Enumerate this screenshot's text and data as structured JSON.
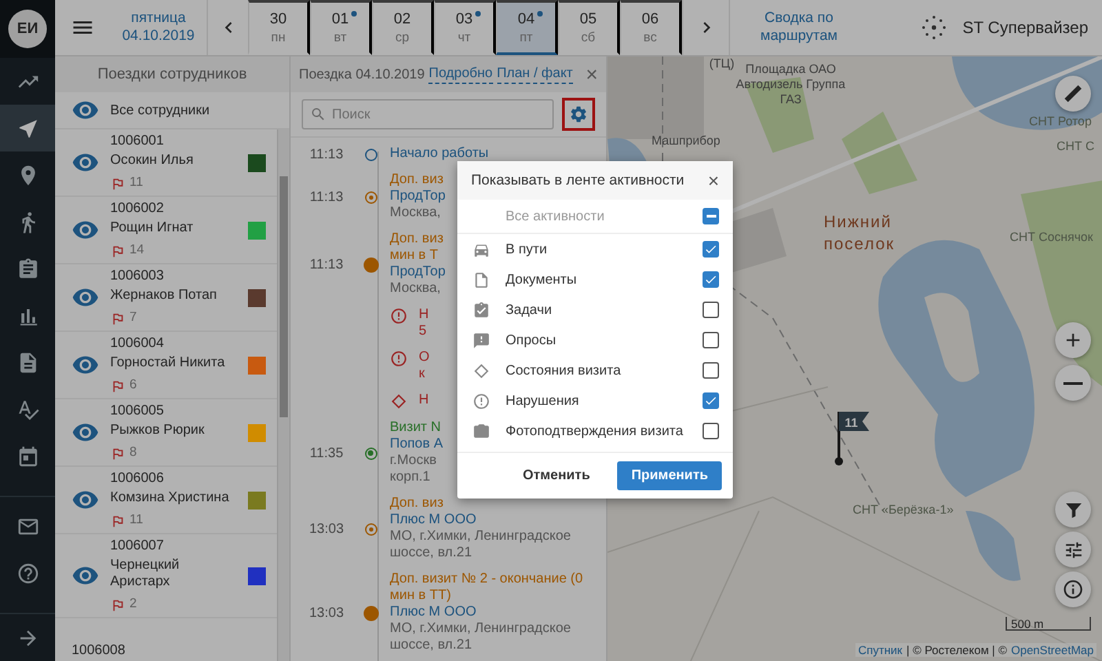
{
  "user": {
    "initials": "ЕИ"
  },
  "nav_items": [
    {
      "selected": false
    },
    {
      "selected": true
    },
    {
      "selected": false
    },
    {
      "selected": false
    },
    {
      "selected": false
    },
    {
      "selected": false
    },
    {
      "selected": false
    },
    {
      "selected": false
    },
    {
      "selected": false
    },
    {
      "selected": false
    },
    {
      "selected": false
    }
  ],
  "header": {
    "weekday": "пятница",
    "date": "04.10.2019",
    "days": [
      {
        "num": "30",
        "dow": "пн",
        "marker": false,
        "selected": false
      },
      {
        "num": "01",
        "dow": "вт",
        "marker": true,
        "selected": false
      },
      {
        "num": "02",
        "dow": "ср",
        "marker": false,
        "selected": false
      },
      {
        "num": "03",
        "dow": "чт",
        "marker": true,
        "selected": false
      },
      {
        "num": "04",
        "dow": "пт",
        "marker": true,
        "selected": true
      },
      {
        "num": "05",
        "dow": "сб",
        "marker": false,
        "selected": false
      },
      {
        "num": "06",
        "dow": "вс",
        "marker": false,
        "selected": false
      }
    ],
    "summary_link": "Сводка по маршрутам",
    "user_name": "ST Супервайзер"
  },
  "employees_panel": {
    "title": "Поездки сотрудников",
    "all_label": "Все сотрудники",
    "employees": [
      {
        "id": "1006001",
        "name": "Осокин Илья",
        "flags": "11",
        "color": "#1b4a1e"
      },
      {
        "id": "1006002",
        "name": "Рощин Игнат",
        "flags": "14",
        "color": "#22a044"
      },
      {
        "id": "1006003",
        "name": "Жернаков Потап",
        "flags": "7",
        "color": "#5a3a2e"
      },
      {
        "id": "1006004",
        "name": "Горностай Никита",
        "flags": "6",
        "color": "#c85a10"
      },
      {
        "id": "1006005",
        "name": "Рыжков Рюрик",
        "flags": "8",
        "color": "#d08c00"
      },
      {
        "id": "1006006",
        "name": "Комзина Христина",
        "flags": "11",
        "color": "#7a7a20"
      },
      {
        "id": "1006007",
        "name": "Чернецкий Аристарх",
        "flags": "2",
        "color": "#2030c0"
      },
      {
        "id": "1006008"
      }
    ]
  },
  "trip_panel": {
    "title": "Поездка 04.10.2019",
    "links": [
      "Подробно",
      "План / факт"
    ],
    "close": "×",
    "search": {
      "placeholder": "Поиск"
    },
    "settings_button": {
      "highlighted": true
    },
    "events": [
      {
        "time": "11:13",
        "kind": "open",
        "lines": [
          {
            "kind": "start",
            "text": "Начало работы"
          }
        ]
      },
      {
        "time": "11:13",
        "kind": "ring",
        "lines": [
          {
            "kind": "title",
            "text": "Доп. виз"
          },
          {
            "kind": "company",
            "text": "ПродТор"
          },
          {
            "kind": "address",
            "text": "Москва,"
          }
        ]
      },
      {
        "time": "11:13",
        "kind": "filled",
        "lines": [
          {
            "kind": "title",
            "text": "Доп. виз"
          },
          {
            "kind": "title",
            "text": "мин в Т"
          },
          {
            "kind": "company",
            "text": "ПродТор"
          },
          {
            "kind": "address",
            "text": "Москва,"
          }
        ]
      },
      {
        "kind": "alert",
        "lines": [
          {
            "kind": "violation",
            "text": "Н"
          },
          {
            "kind": "violation",
            "text": "5"
          }
        ]
      },
      {
        "kind": "alert",
        "lines": [
          {
            "kind": "violation",
            "text": "О"
          },
          {
            "kind": "violation",
            "text": "к"
          }
        ]
      },
      {
        "kind": "diamond",
        "lines": [
          {
            "kind": "violation",
            "text": "Н"
          }
        ]
      },
      {
        "time": "11:35",
        "kind": "visit",
        "lines": [
          {
            "kind": "visit",
            "text": "Визит N"
          },
          {
            "kind": "company",
            "text": "Попов А"
          },
          {
            "kind": "address",
            "text": "г.Москв"
          },
          {
            "kind": "address",
            "text": "корп.1"
          }
        ]
      },
      {
        "time": "13:03",
        "kind": "ring",
        "lines": [
          {
            "kind": "title",
            "text": "Доп. виз"
          },
          {
            "kind": "company",
            "text": "Плюс М ООО"
          },
          {
            "kind": "address",
            "text": "МО, г.Химки, Ленинградское шоссе, вл.21"
          }
        ]
      },
      {
        "time": "13:03",
        "kind": "filled",
        "lines": [
          {
            "kind": "title",
            "text": "Доп. визит № 2 - окончание (0 мин в ТТ)"
          },
          {
            "kind": "company",
            "text": "Плюс М ООО"
          },
          {
            "kind": "address",
            "text": "МО, г.Химки, Ленинградское шоссе, вл.21"
          }
        ]
      }
    ]
  },
  "map": {
    "labels": [
      {
        "kind": "poi",
        "text": "(ТЦ)"
      },
      {
        "kind": "poi",
        "text": "Площадка ОАО Автодизель Группа ГАЗ"
      },
      {
        "kind": "poi",
        "text": "Машприбор"
      },
      {
        "kind": "snt",
        "text": "СНТ Ротор"
      },
      {
        "kind": "snt",
        "text": "СНТ С"
      },
      {
        "kind": "snt",
        "text": "СНТ Соснячок"
      },
      {
        "kind": "settlement",
        "text": "Нижний поселок"
      },
      {
        "kind": "snt",
        "text": "СНТ «Берёзка-1»"
      }
    ],
    "marker": {
      "label": "11"
    },
    "scale": "500 m",
    "attribution": [
      {
        "text": "Спутник",
        "link": true
      },
      {
        "text": "| © Ростелеком | ©",
        "link": false
      },
      {
        "text": "OpenStreetMap",
        "link": true
      }
    ]
  },
  "dialog": {
    "title": "Показывать в ленте активности",
    "close": "×",
    "all": {
      "label": "Все активности",
      "indeterminate": true
    },
    "items": [
      {
        "label": "В пути",
        "checked": true
      },
      {
        "label": "Документы",
        "checked": true
      },
      {
        "label": "Задачи",
        "checked": false
      },
      {
        "label": "Опросы",
        "checked": false
      },
      {
        "label": "Состояния визита",
        "checked": false
      },
      {
        "label": "Нарушения",
        "checked": true
      },
      {
        "label": "Фотоподтверждения визита",
        "checked": false
      }
    ],
    "buttons": [
      {
        "label": "Отменить",
        "kind": "text"
      },
      {
        "label": "Применить",
        "kind": "primary"
      }
    ]
  }
}
